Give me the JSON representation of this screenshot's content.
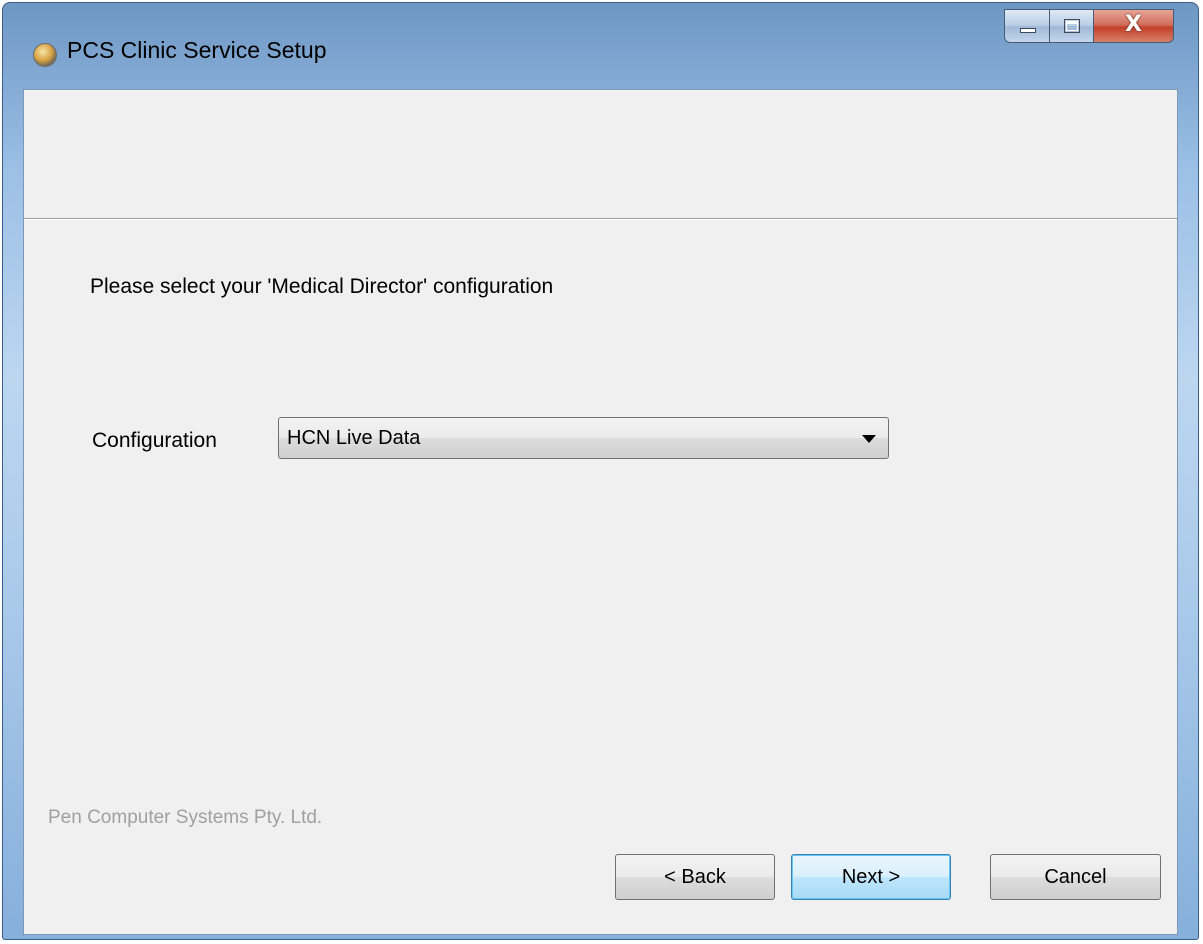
{
  "window": {
    "title": "PCS Clinic Service Setup",
    "icon": "setup-app-icon",
    "controls": {
      "minimize_icon": "minimize-icon",
      "maximize_icon": "maximize-icon",
      "close_label": "X"
    }
  },
  "content": {
    "instruction": "Please select your 'Medical Director' configuration",
    "configuration": {
      "label": "Configuration",
      "selected_value": "HCN Live Data"
    },
    "brand": "Pen Computer Systems Pty. Ltd."
  },
  "buttons": {
    "back": "< Back",
    "next": "Next >",
    "cancel": "Cancel"
  },
  "colors": {
    "frame": "#9cc0e6",
    "client_background": "#f0f0f0",
    "close_button": "#c2412a",
    "default_button_border": "#3c7fb1",
    "brand_text": "#a0a0a0"
  }
}
